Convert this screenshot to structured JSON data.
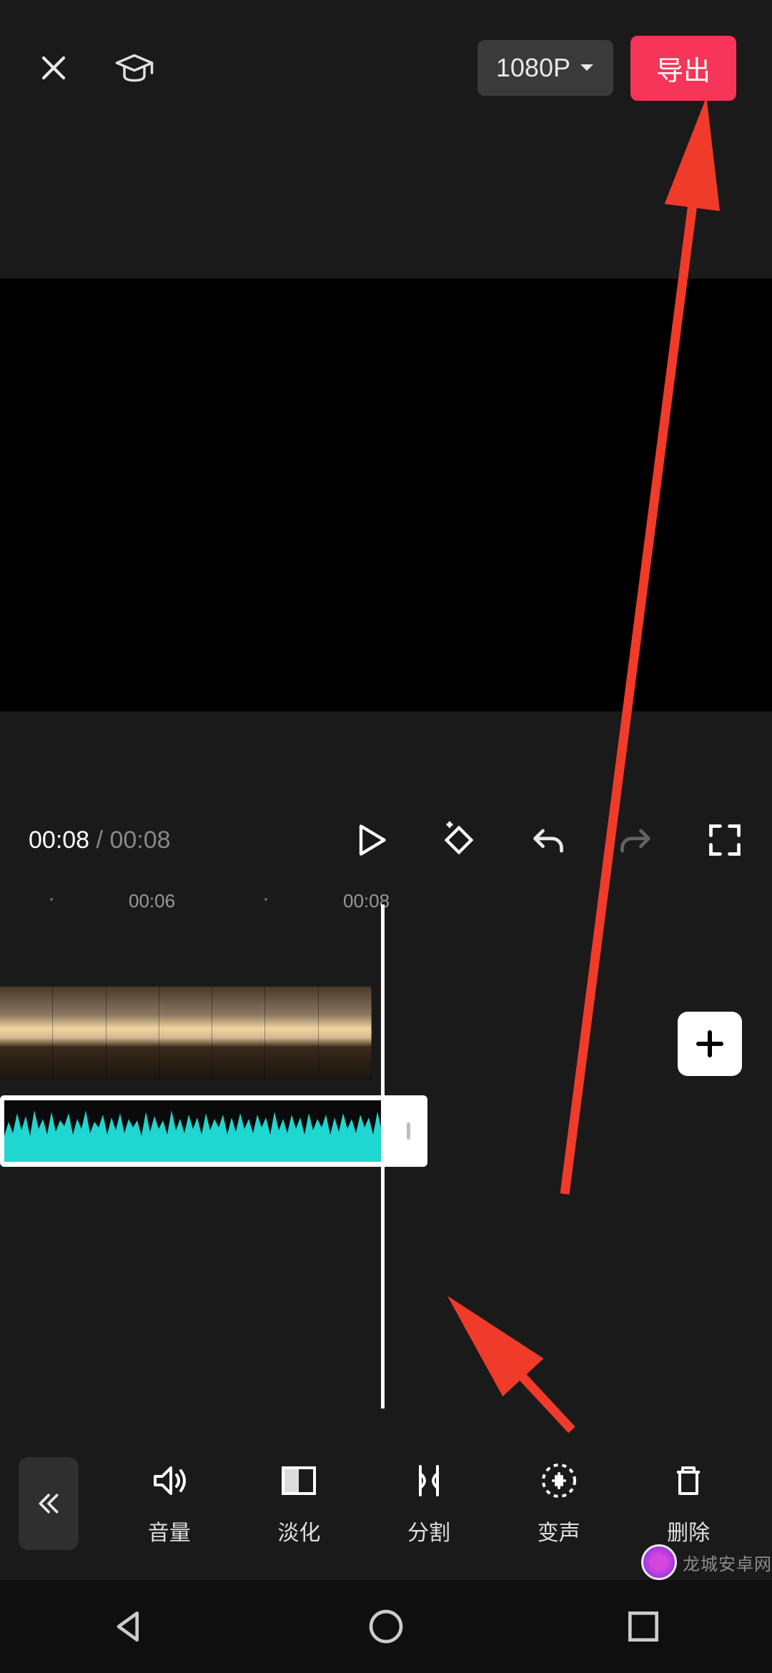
{
  "header": {
    "resolution_label": "1080P",
    "export_label": "导出"
  },
  "time": {
    "current": "00:08",
    "separator": " / ",
    "total": "00:08"
  },
  "ruler": {
    "labels": [
      "00:06",
      "00:08"
    ]
  },
  "tools": [
    {
      "name": "volume",
      "label": "音量"
    },
    {
      "name": "fade",
      "label": "淡化"
    },
    {
      "name": "split",
      "label": "分割"
    },
    {
      "name": "voicechange",
      "label": "变声"
    },
    {
      "name": "delete",
      "label": "删除"
    }
  ],
  "watermark": {
    "text": "龙城安卓网"
  }
}
